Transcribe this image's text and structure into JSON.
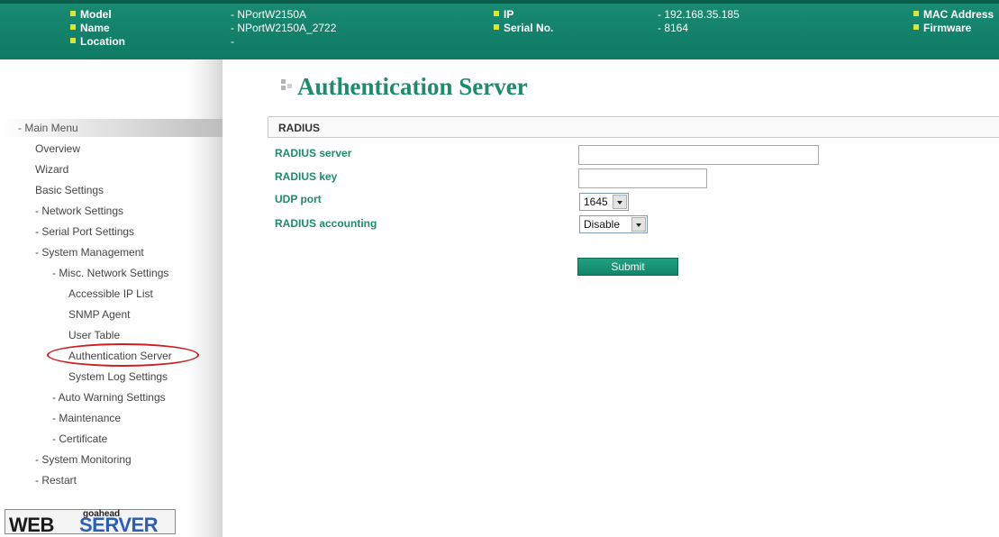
{
  "header": {
    "model_label": "Model",
    "model_value": "- NPortW2150A",
    "name_label": "Name",
    "name_value": "- NPortW2150A_2722",
    "location_label": "Location",
    "location_value": "-",
    "ip_label": "IP",
    "ip_value": "- 192.168.35.185",
    "serial_label": "Serial No.",
    "serial_value": "- 8164",
    "mac_label": "MAC Address",
    "firmware_label": "Firmware"
  },
  "sidebar": {
    "header": "- Main Menu",
    "items": [
      "Overview",
      "Wizard",
      "Basic Settings",
      "- Network Settings",
      "- Serial Port Settings",
      "- System Management",
      "- Misc. Network Settings",
      "Accessible IP List",
      "SNMP Agent",
      "User Table",
      "Authentication Server",
      "System Log Settings",
      "- Auto Warning Settings",
      "- Maintenance",
      "- Certificate",
      "- System Monitoring",
      "- Restart"
    ],
    "logo_top": "goahead",
    "logo_web": "WEB",
    "logo_server": "SERVER"
  },
  "main": {
    "title": "Authentication Server",
    "section": "RADIUS",
    "fields": {
      "radius_server": {
        "label": "RADIUS server",
        "value": ""
      },
      "radius_key": {
        "label": "RADIUS key",
        "value": ""
      },
      "udp_port": {
        "label": "UDP port",
        "value": "1645"
      },
      "radius_accounting": {
        "label": "RADIUS accounting",
        "value": "Disable"
      }
    },
    "submit_label": "Submit"
  },
  "colors": {
    "header_bg": "#0e7a63",
    "accent": "#1f8a6c",
    "bullet": "#d8e63a",
    "highlight_ring": "#cc1f1f"
  }
}
